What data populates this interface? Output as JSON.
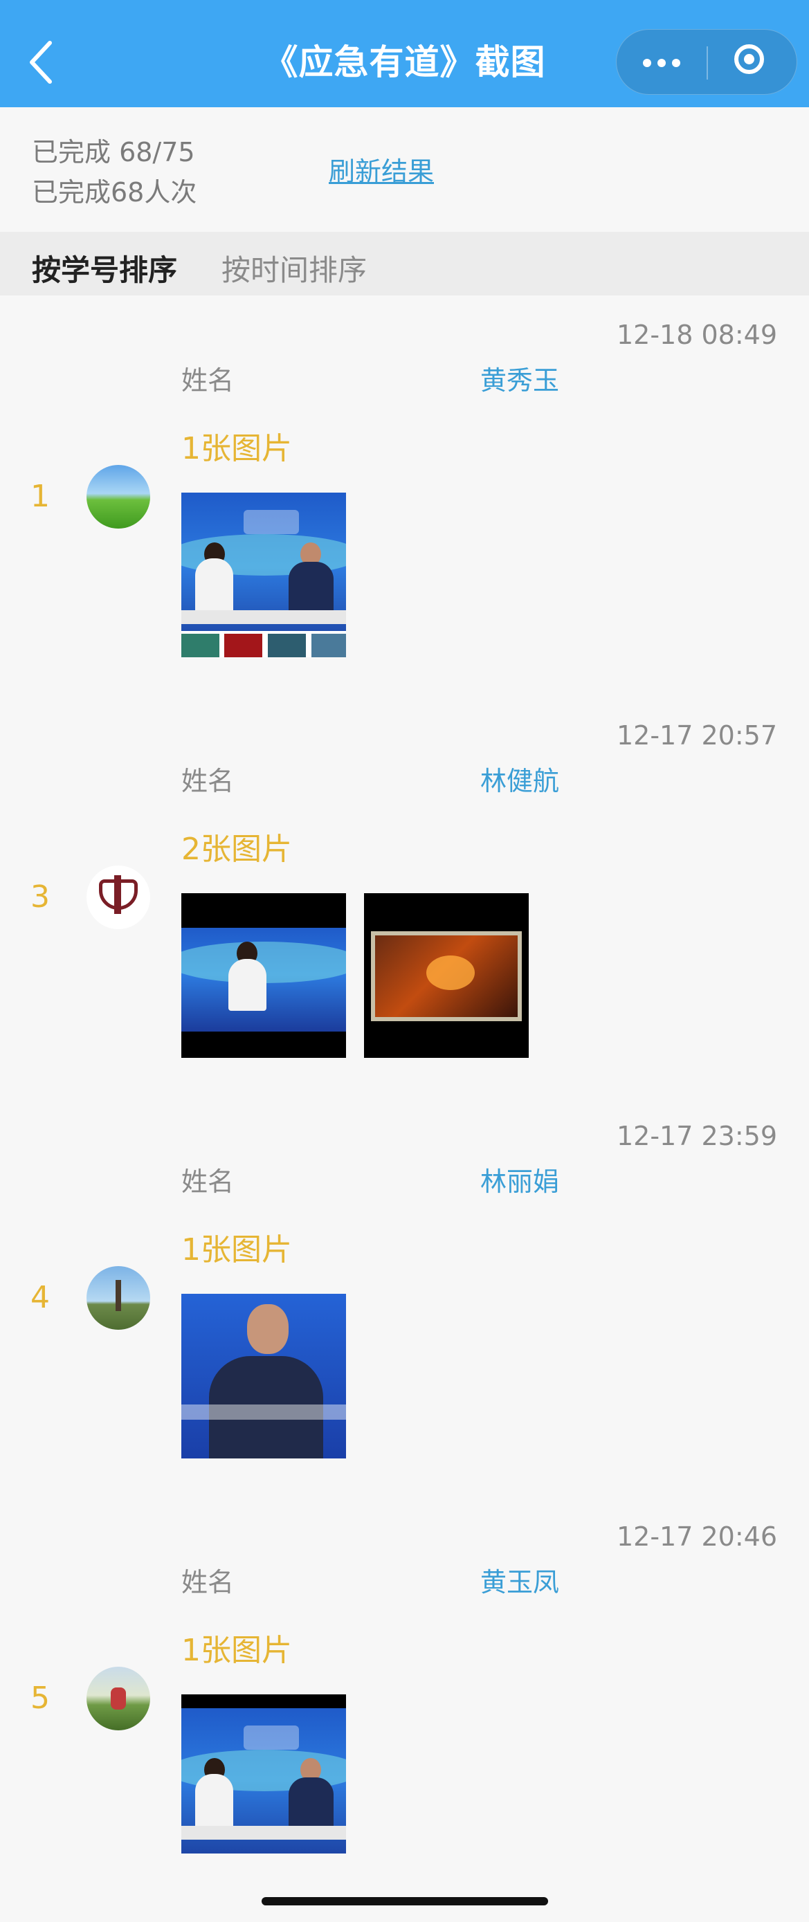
{
  "header": {
    "title": "《应急有道》截图",
    "back_icon": "chevron-left-icon",
    "more_icon": "more-dots-icon",
    "close_icon": "target-close-icon"
  },
  "summary": {
    "completed_count": "已完成 68/75",
    "completed_times": "已完成68人次",
    "refresh_label": "刷新结果"
  },
  "sort_tabs": {
    "by_id": "按学号排序",
    "by_time": "按时间排序"
  },
  "entries": [
    {
      "index": "1",
      "time": "12-18 08:49",
      "name_label": "姓名",
      "name": "黄秀玉",
      "image_count": "1张图片"
    },
    {
      "index": "3",
      "time": "12-17 20:57",
      "name_label": "姓名",
      "name": "林健航",
      "image_count": "2张图片"
    },
    {
      "index": "4",
      "time": "12-17 23:59",
      "name_label": "姓名",
      "name": "林丽娟",
      "image_count": "1张图片"
    },
    {
      "index": "5",
      "time": "12-17 20:46",
      "name_label": "姓名",
      "name": "黄玉凤",
      "image_count": "1张图片"
    }
  ],
  "colors": {
    "header_bg": "#3ea7f3",
    "accent_blue": "#3a9ed6",
    "accent_gold": "#e6b534",
    "muted_text": "#8a8a8a"
  }
}
